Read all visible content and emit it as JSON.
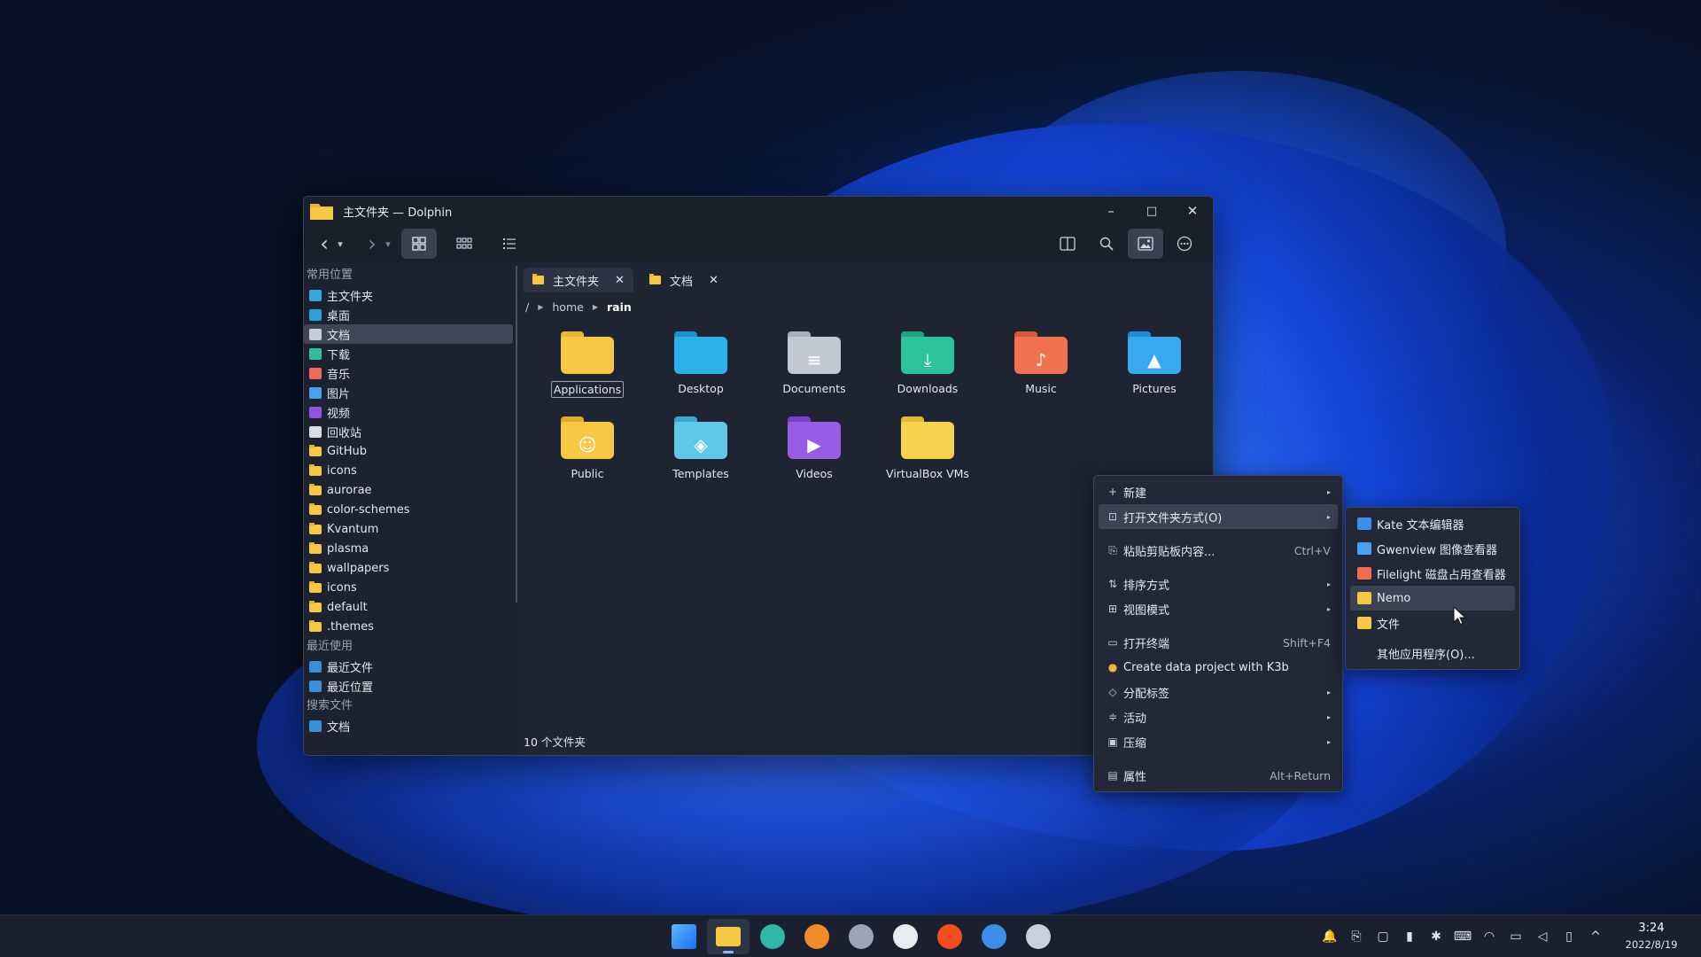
{
  "window": {
    "title": "主文件夹 — Dolphin",
    "controls": {
      "minimize": "–",
      "maximize": "□",
      "close": "✕"
    }
  },
  "toolbar": {
    "back": "‹",
    "back_dropdown": "▾",
    "forward": "›",
    "forward_dropdown": "▾",
    "view_icons": "⊞",
    "view_compact": "▦",
    "view_details": "☰",
    "split": "◫",
    "search": "⌕",
    "preview": "▣",
    "menu": "⋯"
  },
  "sidebar": {
    "places_header": "常用位置",
    "places": [
      {
        "label": "主文件夹",
        "icon": "home-icon",
        "color": "#3aa6e0"
      },
      {
        "label": "桌面",
        "icon": "desktop-icon",
        "color": "#2ba0d8"
      },
      {
        "label": "文档",
        "icon": "document-icon",
        "color": "#c7ccd6",
        "selected": true
      },
      {
        "label": "下载",
        "icon": "download-icon",
        "color": "#2fbf9c"
      },
      {
        "label": "音乐",
        "icon": "music-icon",
        "color": "#ef6a5a"
      },
      {
        "label": "图片",
        "icon": "image-icon",
        "color": "#4aa0ea"
      },
      {
        "label": "视频",
        "icon": "video-icon",
        "color": "#8e56e0"
      },
      {
        "label": "回收站",
        "icon": "trash-icon",
        "color": "#d8dce6"
      },
      {
        "label": "GitHub",
        "icon": "folder-icon"
      },
      {
        "label": "icons",
        "icon": "folder-icon"
      },
      {
        "label": "aurorae",
        "icon": "folder-icon"
      },
      {
        "label": "color-schemes",
        "icon": "folder-icon"
      },
      {
        "label": "Kvantum",
        "icon": "folder-icon"
      },
      {
        "label": "plasma",
        "icon": "folder-icon"
      },
      {
        "label": "wallpapers",
        "icon": "folder-icon"
      },
      {
        "label": "icons",
        "icon": "folder-icon"
      },
      {
        "label": "default",
        "icon": "folder-icon"
      },
      {
        "label": ".themes",
        "icon": "folder-icon"
      }
    ],
    "recent_header": "最近使用",
    "recent": [
      {
        "label": "最近文件",
        "icon": "recent-files-icon"
      },
      {
        "label": "最近位置",
        "icon": "recent-locations-icon"
      }
    ],
    "search_header": "搜索文件",
    "search": [
      {
        "label": "文档",
        "icon": "document-icon"
      }
    ]
  },
  "tabs": [
    {
      "label": "主文件夹",
      "active": true,
      "close": "✕"
    },
    {
      "label": "文档",
      "active": false,
      "close": "✕"
    }
  ],
  "breadcrumb": {
    "root": "/",
    "parts": [
      "home",
      "rain"
    ]
  },
  "files": [
    {
      "name": "Applications",
      "color": "#f6c844",
      "tab": "#e8b632",
      "glyph": "",
      "focused": true
    },
    {
      "name": "Desktop",
      "color": "#2cb2e8",
      "tab": "#1e8fca",
      "glyph": ""
    },
    {
      "name": "Documents",
      "color": "#c3c9d4",
      "tab": "#a7afbd",
      "glyph": "≡"
    },
    {
      "name": "Downloads",
      "color": "#2bc29e",
      "tab": "#1ea482",
      "glyph": "⤓"
    },
    {
      "name": "Music",
      "color": "#f0724e",
      "tab": "#d85a3c",
      "glyph": "♪"
    },
    {
      "name": "Pictures",
      "color": "#38a8f0",
      "tab": "#1f8ad4",
      "glyph": "▲"
    },
    {
      "name": "Public",
      "color": "#f6c844",
      "tab": "#e0a92a",
      "glyph": "☺"
    },
    {
      "name": "Templates",
      "color": "#5ec8e8",
      "tab": "#3aa6cc",
      "glyph": "◈"
    },
    {
      "name": "Videos",
      "color": "#9a5ce6",
      "tab": "#7a40cc",
      "glyph": "▶"
    },
    {
      "name": "VirtualBox VMs",
      "color": "#f8d24c",
      "tab": "#e8b632",
      "glyph": ""
    }
  ],
  "status": {
    "text": "10 个文件夹"
  },
  "context_menu": {
    "items": [
      {
        "icon": "+",
        "label": "新建",
        "submenu": true
      },
      {
        "icon": "⊡",
        "label": "打开文件夹方式(O)",
        "submenu": true,
        "highlighted": true
      },
      {
        "sep": true
      },
      {
        "icon": "⎘",
        "label": "粘贴剪贴板内容...",
        "shortcut": "Ctrl+V"
      },
      {
        "sep": true
      },
      {
        "icon": "⇅",
        "label": "排序方式",
        "submenu": true
      },
      {
        "icon": "⊞",
        "label": "视图模式",
        "submenu": true
      },
      {
        "sep": true
      },
      {
        "icon": "▭",
        "label": "打开终端",
        "shortcut": "Shift+F4"
      },
      {
        "icon": "●",
        "label": "Create data project with K3b"
      },
      {
        "icon": "◇",
        "label": "分配标签",
        "submenu": true
      },
      {
        "icon": "≑",
        "label": "活动",
        "submenu": true
      },
      {
        "icon": "▣",
        "label": "压缩",
        "submenu": true
      },
      {
        "sep": true
      },
      {
        "icon": "▤",
        "label": "属性",
        "shortcut": "Alt+Return"
      }
    ],
    "submenu_arrow": "▸"
  },
  "open_with_menu": {
    "items": [
      {
        "label": "Kate 文本编辑器",
        "color": "#3d8ee8"
      },
      {
        "label": "Gwenview 图像查看器",
        "color": "#4aa0ea"
      },
      {
        "label": "Filelight 磁盘占用查看器",
        "color": "#f06a4e"
      },
      {
        "label": "Nemo",
        "color": "#f6c844",
        "highlighted": true
      },
      {
        "label": "文件",
        "color": "#f6c844"
      },
      {
        "sep": true
      },
      {
        "label": "其他应用程序(O)...",
        "color": ""
      }
    ]
  },
  "taskbar": {
    "apps": [
      {
        "name": "start-menu",
        "color": "#3d9bf0"
      },
      {
        "name": "dolphin",
        "color": "#f6c844",
        "active": true
      },
      {
        "name": "edge-dev",
        "color": "#2fb8a8"
      },
      {
        "name": "firefox",
        "color": "#f28a2b"
      },
      {
        "name": "settings",
        "color": "#9aa6b8"
      },
      {
        "name": "github",
        "color": "#e8ebf2"
      },
      {
        "name": "figma",
        "color": "#f24e1e"
      },
      {
        "name": "store",
        "color": "#3d8ee8"
      },
      {
        "name": "virtualbox",
        "color": "#c9cfdb"
      }
    ],
    "tray": [
      "🔔",
      "⎘",
      "▢",
      "▮",
      "✱",
      "⌨",
      "◠",
      "▭",
      "◁",
      "▯",
      "^"
    ],
    "time": "3:24",
    "date": "2022/8/19"
  }
}
